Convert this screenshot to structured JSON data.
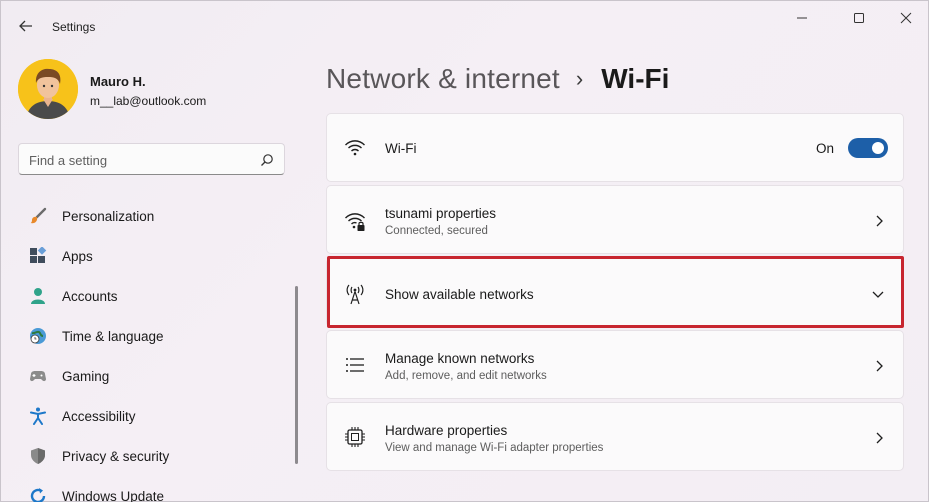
{
  "app": {
    "title": "Settings"
  },
  "user": {
    "name": "Mauro H.",
    "email": "m__lab@outlook.com"
  },
  "search": {
    "placeholder": "Find a setting"
  },
  "sidebar": {
    "items": [
      {
        "label": "Personalization",
        "icon": "paintbrush-icon"
      },
      {
        "label": "Apps",
        "icon": "apps-icon"
      },
      {
        "label": "Accounts",
        "icon": "person-icon"
      },
      {
        "label": "Time & language",
        "icon": "globe-clock-icon"
      },
      {
        "label": "Gaming",
        "icon": "gamepad-icon"
      },
      {
        "label": "Accessibility",
        "icon": "accessibility-icon"
      },
      {
        "label": "Privacy & security",
        "icon": "shield-icon"
      },
      {
        "label": "Windows Update",
        "icon": "update-icon"
      }
    ]
  },
  "breadcrumb": {
    "parent": "Network & internet",
    "separator": "›",
    "current": "Wi-Fi"
  },
  "cards": {
    "wifi": {
      "title": "Wi-Fi",
      "state": "On",
      "icon": "wifi-icon"
    },
    "properties": {
      "title": "tsunami properties",
      "subtitle": "Connected, secured",
      "icon": "wifi-secure-icon"
    },
    "available": {
      "title": "Show available networks",
      "icon": "antenna-icon"
    },
    "known": {
      "title": "Manage known networks",
      "subtitle": "Add, remove, and edit networks",
      "icon": "list-icon"
    },
    "hardware": {
      "title": "Hardware properties",
      "subtitle": "View and manage Wi-Fi adapter properties",
      "icon": "chip-icon"
    }
  },
  "colors": {
    "accent": "#1d5fa8",
    "highlight": "#c7252f",
    "avatar_bg": "#f7c21a"
  }
}
